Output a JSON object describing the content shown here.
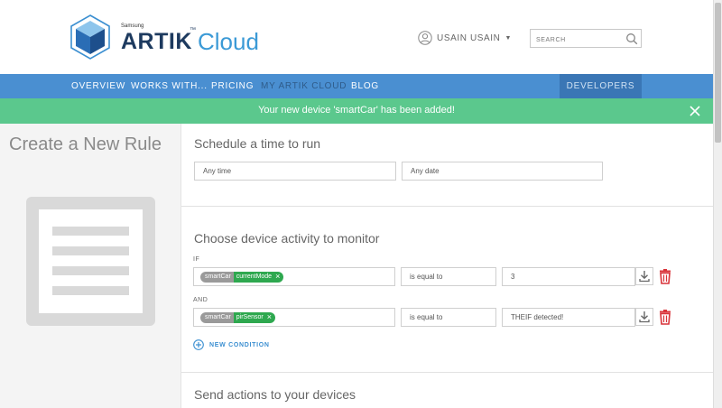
{
  "brand": {
    "samsung": "Samsung",
    "artik": "ARTIK",
    "tm": "™",
    "cloud": "Cloud"
  },
  "user": {
    "name": "USAIN USAIN",
    "caret": "▼"
  },
  "search": {
    "placeholder": "SEARCH"
  },
  "nav": {
    "items": [
      "OVERVIEW",
      "WORKS WITH...",
      "PRICING",
      "MY ARTIK CLOUD",
      "BLOG"
    ],
    "active": "MY ARTIK CLOUD",
    "developers": "DEVELOPERS"
  },
  "alert": {
    "message": "Your new device 'smartCar' has been added!"
  },
  "page_title": "Create a New Rule",
  "schedule": {
    "title": "Schedule a time to run",
    "time_value": "Any time",
    "date_value": "Any date"
  },
  "monitor": {
    "title": "Choose device activity to monitor",
    "conditions": [
      {
        "label": "IF",
        "device": "smartCar",
        "field": "currentMode",
        "operator": "is equal to",
        "value": "3"
      },
      {
        "label": "AND",
        "device": "smartCar",
        "field": "pirSensor",
        "operator": "is equal to",
        "value": "THEIF detected!"
      }
    ],
    "new_condition": "NEW CONDITION"
  },
  "actions": {
    "title": "Send actions to your devices"
  },
  "colors": {
    "nav": "#4a8fd1",
    "developers": "#3a76b5",
    "alert": "#5bc88d",
    "tag_device": "#9a9a9a",
    "tag_field": "#2ea84f",
    "delete": "#d9343a",
    "link": "#3b8fd1"
  },
  "icons": [
    "cube-logo-icon",
    "user-avatar-icon",
    "search-icon",
    "close-icon",
    "document-icon",
    "download-icon",
    "trash-icon",
    "plus-circle-icon"
  ]
}
